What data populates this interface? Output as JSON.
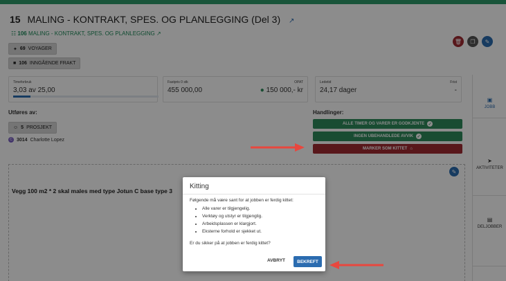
{
  "header": {
    "job_number": "15",
    "title": "MALING - KONTRAKT, SPES. OG PLANLEGGING (Del 3)",
    "parent_number": "106",
    "parent_title": "MALING - KONTRAKT, SPES. OG PLANLEGGING"
  },
  "chips": {
    "voyages_count": "69",
    "voyages_label": "VOYAGER",
    "freight_count": "106",
    "freight_label": "INNGÅENDE FRAKT",
    "project_count": "5",
    "project_label": "PROSJEKT"
  },
  "cards": {
    "time": {
      "label": "Timeforbruk",
      "value": "3,03 av 25,00",
      "progress": 0.12
    },
    "price": {
      "label": "Fastpris 0 stk",
      "value": "455 000,00",
      "label_right": "OPAT",
      "value_right": "150 000,- kr"
    },
    "lead": {
      "label": "Ledetid",
      "value": "24,17 dager",
      "label_right": "Frist",
      "value_right": "-"
    }
  },
  "performed_by": {
    "label": "Utføres av:",
    "person_number": "3014",
    "person_name": "Charlotte Lopez"
  },
  "actions": {
    "label": "Handlinger:",
    "items": [
      "ALLE TIMER OG VARER ER GODKJENTE",
      "INGEN UBEHANDLEDE AVVIK",
      "MARKER SOM KITTET"
    ]
  },
  "right_tabs": [
    "JOBB",
    "AKTIVITETER",
    "DELJOBBER"
  ],
  "description": "Vegg 100 m2 *  2 skal males med type Jotun C base type 3",
  "modal": {
    "title": "Kitting",
    "intro": "Følgende må være sant for at jobben er ferdig kittet:",
    "items": [
      "Alle varer er tilgjengelig.",
      "Verktøy og utstyr er tilgjenglig.",
      "Arbeidsplassen er klargjort.",
      "Eksterne forhold er sjekket ut."
    ],
    "question": "Er du sikker på at jobben er ferdig kittet?",
    "cancel_label": "AVBRYT",
    "confirm_label": "BEKREFT"
  },
  "colors": {
    "green": "#2e8a5c",
    "red": "#a12a32",
    "blue": "#2b6cb0",
    "arrow": "#e8473e"
  }
}
